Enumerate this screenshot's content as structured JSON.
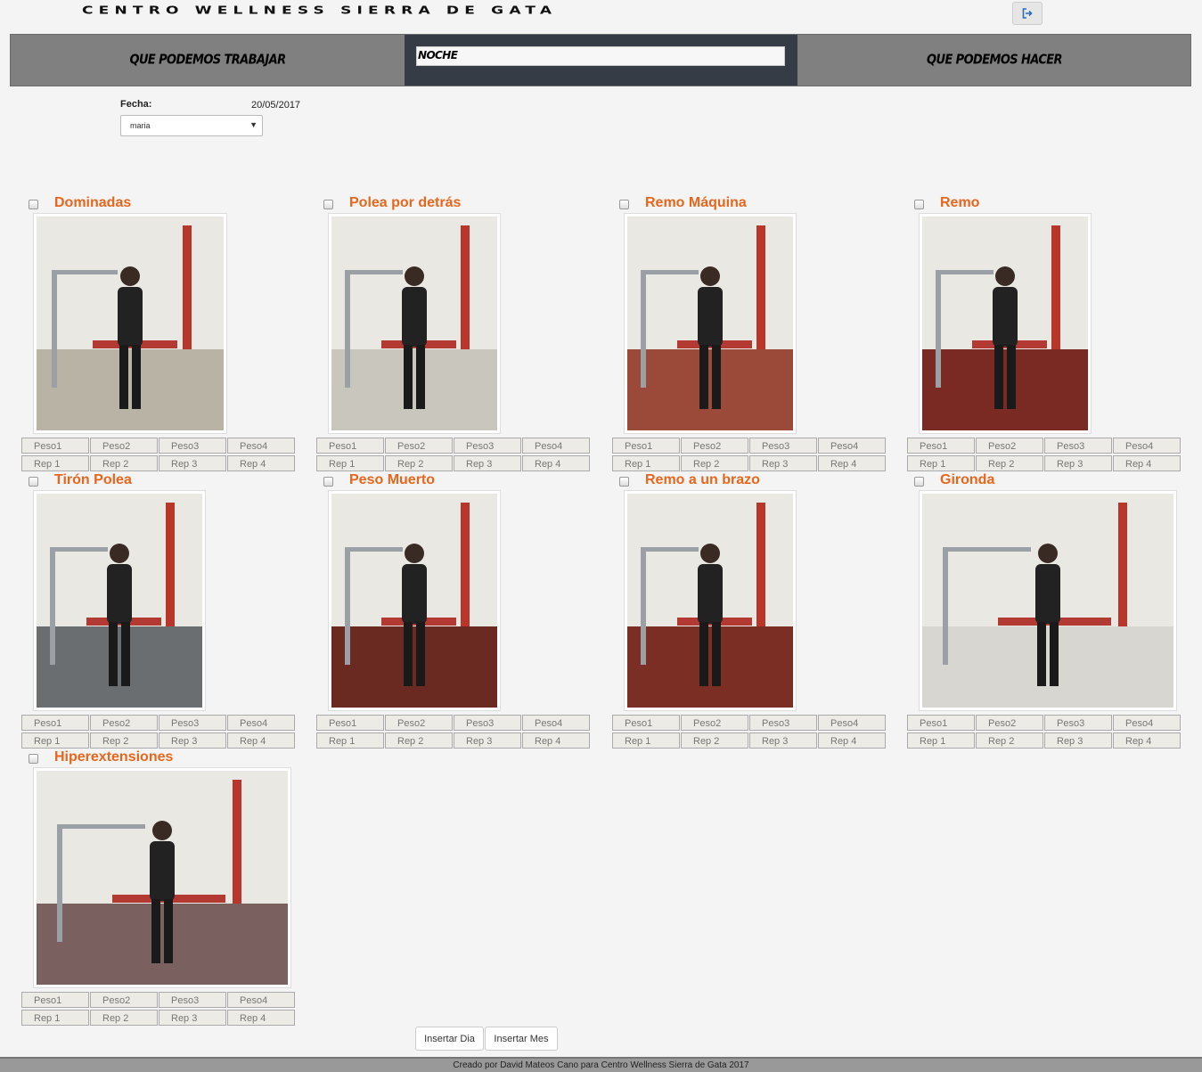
{
  "header": {
    "brand": "CENTRO WELLNESS SIERRA DE GATA",
    "logout_icon": "sign-out-icon"
  },
  "nav": {
    "left": "QUE PODEMOS TRABAJAR",
    "center_value": "NOCHE",
    "right": "QUE PODEMOS HACER"
  },
  "form": {
    "fecha_label": "Fecha:",
    "fecha_value": "20/05/2017",
    "user_selected": "maria"
  },
  "grid_labels": {
    "peso": [
      "Peso1",
      "Peso2",
      "Peso3",
      "Peso4"
    ],
    "rep": [
      "Rep 1",
      "Rep 2",
      "Rep 3",
      "Rep 4"
    ]
  },
  "exercises": [
    {
      "name": "Dominadas"
    },
    {
      "name": "Polea por detrás"
    },
    {
      "name": "Remo Máquina"
    },
    {
      "name": "Remo"
    },
    {
      "name": "Tirón Polea"
    },
    {
      "name": "Peso Muerto"
    },
    {
      "name": "Remo a un brazo"
    },
    {
      "name": "Gironda"
    },
    {
      "name": "Hiperextensiones"
    }
  ],
  "actions": {
    "insert_day": "Insertar Dia",
    "insert_month": "Insertar Mes"
  },
  "footer": {
    "text": "Creado por David Mateos Cano para Centro Wellness Sierra de Gata 2017"
  }
}
